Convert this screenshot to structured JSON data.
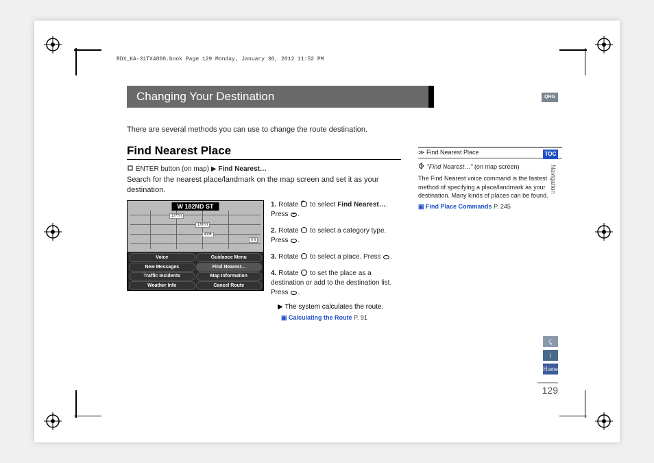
{
  "header_stamp": "RDX_KA-31TX4800.book  Page 129  Monday, January 30, 2012  11:52 PM",
  "title": "Changing Your Destination",
  "qrg_label": "QRG",
  "toc_label": "TOC",
  "nav_label": "Navigation",
  "intro": "There are several methods you can use to change the route destination.",
  "section": "Find Nearest Place",
  "breadcrumb": {
    "pre": "ENTER button (on map)",
    "arrow": "▶",
    "item": "Find Nearest…"
  },
  "description": "Search for the nearest place/landmark on the map screen and set it as your destination.",
  "screenshot": {
    "street": "W 182ND ST",
    "labels": {
      "a": "177TH",
      "b": "178TH",
      "c": "400ft",
      "d": "0 ft"
    },
    "menu": [
      "Voice",
      "Guidance Menu",
      "New Messages",
      "Find Nearest...",
      "Traffic Incidents",
      "Map Information",
      "Weather Info",
      "Cancel Route"
    ],
    "highlight_index": 3
  },
  "steps": [
    {
      "n": "1.",
      "pre": "Rotate ",
      "mid": " to select ",
      "bold": "Find Nearest…",
      "post": ". Press ",
      "end": "."
    },
    {
      "n": "2.",
      "pre": "Rotate ",
      "mid": " to select a category type. Press ",
      "end": "."
    },
    {
      "n": "3.",
      "pre": "Rotate ",
      "mid": " to select a place. Press ",
      "end": "."
    },
    {
      "n": "4.",
      "pre": "Rotate ",
      "mid": " to set the place as a destination or add to the destination list. Press ",
      "end": "."
    }
  ],
  "followup": {
    "arrow": "▶",
    "text": "The system calculates the route."
  },
  "link1": {
    "label": "Calculating the Route",
    "page": "P. 91"
  },
  "sidebar": {
    "head": "Find Nearest Place",
    "voice": "\"Find Nearest…\"",
    "voice_suffix": " (on map screen)",
    "body": "The Find Nearest voice command is the fastest method of specifying a place/landmark as your destination. Many kinds of places can be found.",
    "link": {
      "label": "Find Place Commands",
      "page": "P. 245"
    }
  },
  "side_icons": {
    "voice": "⤹",
    "info": "i",
    "home": "Home"
  },
  "page_number": "129"
}
